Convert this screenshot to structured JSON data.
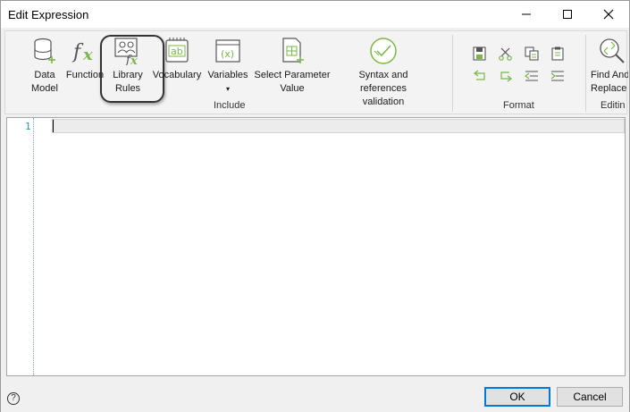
{
  "window": {
    "title": "Edit Expression"
  },
  "ribbon": {
    "include_group": {
      "label": "Include",
      "buttons": [
        {
          "label_line1": "Data",
          "label_line2": "Model"
        },
        {
          "label_line1": "Function",
          "label_line2": ""
        },
        {
          "label_line1": "Library",
          "label_line2": "Rules"
        },
        {
          "label_line1": "Vocabulary",
          "label_line2": ""
        },
        {
          "label_line1": "Variables",
          "label_line2": "▾"
        },
        {
          "label_line1": "Select Parameter",
          "label_line2": "Value"
        },
        {
          "label_line1": "Syntax and references",
          "label_line2": "validation"
        }
      ]
    },
    "format_group": {
      "label": "Format"
    },
    "editing_group": {
      "label": "Editin",
      "find_replace_line1": "Find And",
      "find_replace_line2": "Replace"
    }
  },
  "editor": {
    "line_number": "1",
    "content": ""
  },
  "footer": {
    "help": "?",
    "ok_label": "OK",
    "cancel_label": "Cancel"
  },
  "colors": {
    "accent": "#0078d7",
    "icon_green": "#7ab648",
    "line_number": "#2b91af"
  }
}
